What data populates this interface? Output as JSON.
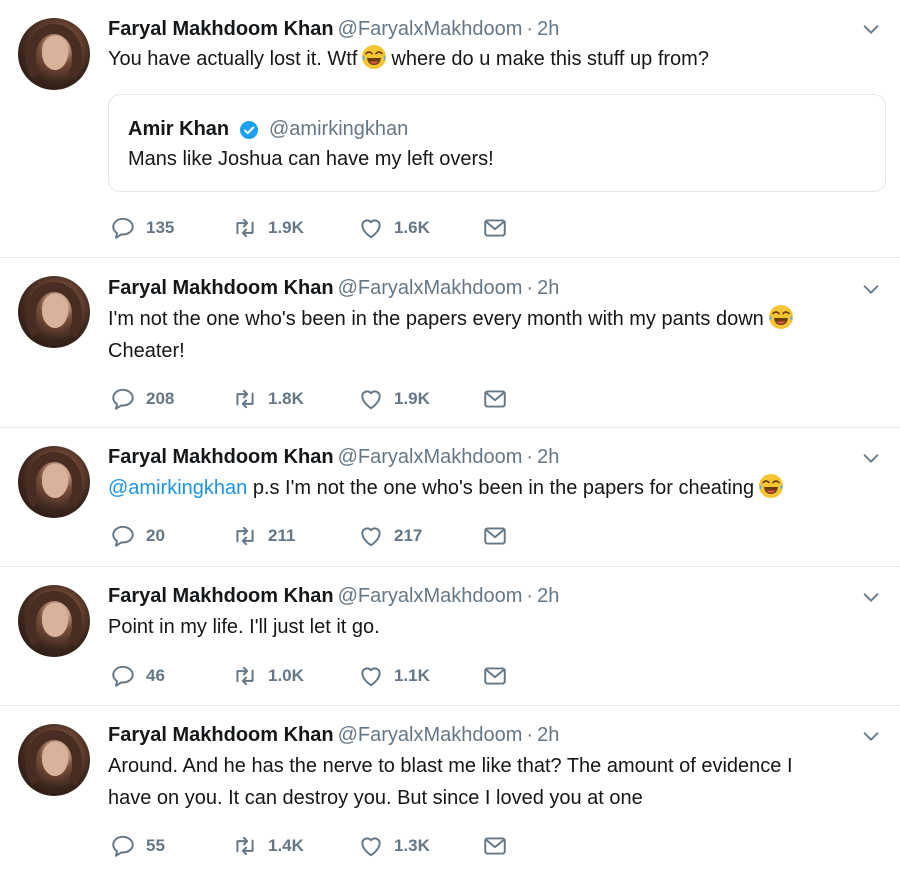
{
  "tweets": [
    {
      "name": "Faryal Makhdoom Khan",
      "handle": "@FaryalxMakhdoom",
      "sep": "·",
      "time": "2h",
      "text_a": "You have actually lost it. Wtf",
      "text_b": "where do u make this stuff up from?",
      "quote": {
        "name": "Amir Khan",
        "handle": "@amirkingkhan",
        "text": "Mans like Joshua can have my left overs!"
      },
      "replies": "135",
      "retweets": "1.9K",
      "likes": "1.6K"
    },
    {
      "name": "Faryal Makhdoom Khan",
      "handle": "@FaryalxMakhdoom",
      "sep": "·",
      "time": "2h",
      "text_a": "I'm not the one who's been in the papers every month with my pants down",
      "text_b": "Cheater!",
      "replies": "208",
      "retweets": "1.8K",
      "likes": "1.9K"
    },
    {
      "name": "Faryal Makhdoom Khan",
      "handle": "@FaryalxMakhdoom",
      "sep": "·",
      "time": "2h",
      "mention": "@amirkingkhan",
      "text_a": "p.s I'm not the one who's been in the papers for cheating",
      "replies": "20",
      "retweets": "211",
      "likes": "217"
    },
    {
      "name": "Faryal Makhdoom Khan",
      "handle": "@FaryalxMakhdoom",
      "sep": "·",
      "time": "2h",
      "text_a": "Point in my life. I'll just let it go.",
      "replies": "46",
      "retweets": "1.0K",
      "likes": "1.1K"
    },
    {
      "name": "Faryal Makhdoom Khan",
      "handle": "@FaryalxMakhdoom",
      "sep": "·",
      "time": "2h",
      "text_a": "Around. And he has the nerve to blast me like that? The amount of evidence I",
      "text_b": "have on you. It can destroy you. But since I loved you at one",
      "replies": "55",
      "retweets": "1.4K",
      "likes": "1.3K"
    }
  ],
  "icons": {
    "reply": "reply-icon",
    "retweet": "retweet-icon",
    "like": "heart-icon",
    "dm": "envelope-icon",
    "more": "chevron-down-icon",
    "emoji": "tears-of-joy-emoji",
    "verified": "verified-badge-icon"
  },
  "colors": {
    "text": "#14171a",
    "muted": "#657786",
    "link": "#1b95e0",
    "border": "#e6ecf0",
    "verified": "#1da1f2",
    "emoji": "#f5c533"
  }
}
